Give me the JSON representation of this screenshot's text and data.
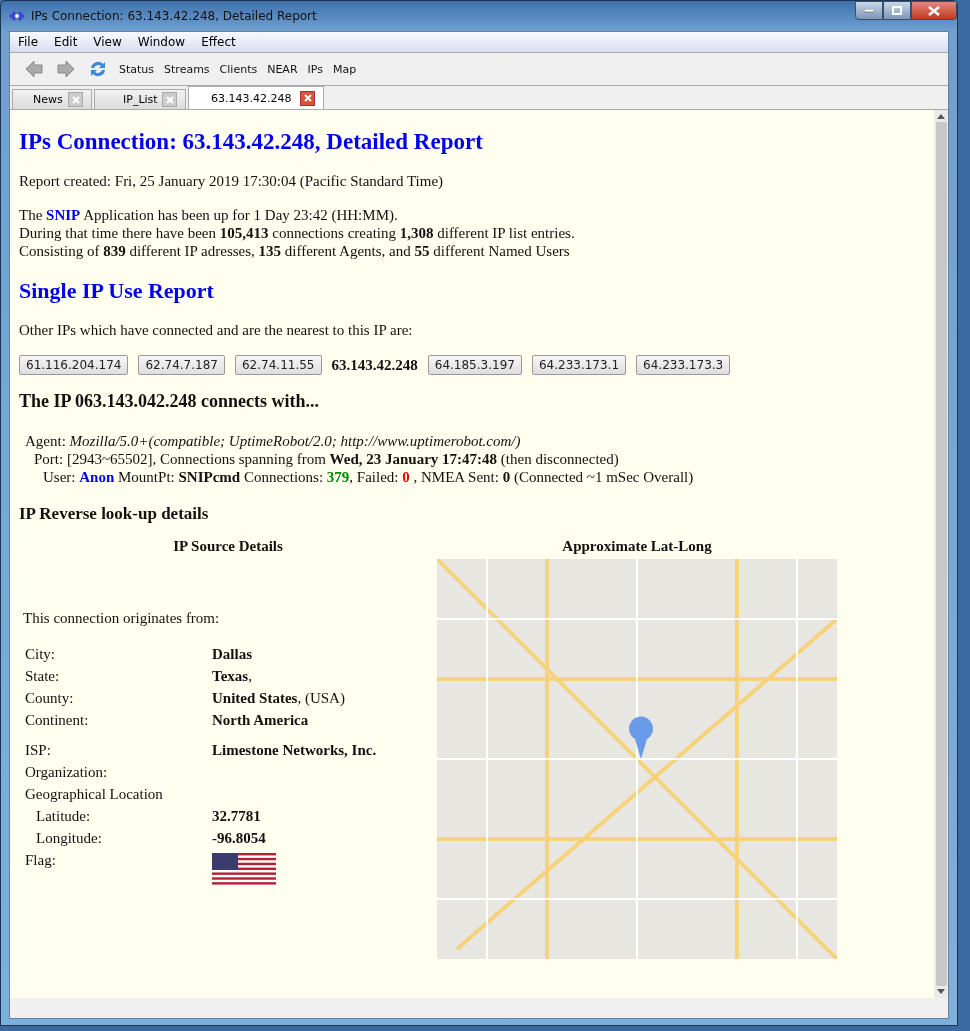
{
  "window": {
    "title": "IPs Connection: 63.143.42.248, Detailed Report"
  },
  "menu": [
    "File",
    "Edit",
    "View",
    "Window",
    "Effect"
  ],
  "toolbar": [
    "Status",
    "Streams",
    "Clients",
    "NEAR",
    "IPs",
    "Map"
  ],
  "tabs": [
    {
      "label": "News",
      "selected": false
    },
    {
      "label": "IP_List",
      "selected": false
    },
    {
      "label": "63.143.42.248",
      "selected": true
    }
  ],
  "report": {
    "title": "IPs Connection: 63.143.42.248, Detailed Report",
    "created": "Report created: Fri, 25 January 2019 17:30:04 (Pacific Standard Time)",
    "summary": [
      [
        {
          "kind": "text",
          "text": "The "
        },
        {
          "kind": "link",
          "text": "SNIP"
        },
        {
          "kind": "text",
          "text": " Application has been up for 1 Day 23:42 (HH:MM)."
        }
      ],
      [
        {
          "kind": "text",
          "text": "During that time there have been **105,413** connections creating **1,308** different IP list entries."
        }
      ],
      [
        {
          "kind": "text",
          "text": "Consisting of **839** different IP adresses, **135** different Agents, and **55** different Named Users"
        }
      ]
    ],
    "section_title": "Single IP Use Report",
    "nearest_intro": "Other IPs which have connected and are the nearest to this IP are:",
    "nearest_ips": [
      {
        "label": "61.116.204.174",
        "selected": false
      },
      {
        "label": "62.74.7.187",
        "selected": false
      },
      {
        "label": "62.74.11.55",
        "selected": false
      },
      {
        "label": "63.143.42.248",
        "selected": true
      },
      {
        "label": "64.185.3.197",
        "selected": false
      },
      {
        "label": "64.233.173.1",
        "selected": false
      },
      {
        "label": "64.233.173.3",
        "selected": false
      }
    ],
    "connects_title": "The IP 063.143.042.248 connects with...",
    "connection_lines": [
      [
        {
          "kind": "text",
          "text": "Agent: *Mozilla/5.0+(compatible; UptimeRobot/2.0; http://www.uptimerobot.com/)*"
        }
      ],
      [
        {
          "kind": "text",
          "text": "Port: [2943~65502], Connections spanning from **Wed, 23 January 17:47:48** (then disconnected)"
        }
      ],
      [
        {
          "kind": "text",
          "text": "User: "
        },
        {
          "kind": "link",
          "text": "Anon"
        },
        {
          "kind": "text",
          "text": " MountPt: **SNIPcmd** Connections: "
        },
        {
          "kind": "good",
          "text": "379"
        },
        {
          "kind": "text",
          "text": ", Failed: "
        },
        {
          "kind": "bad",
          "text": "0"
        },
        {
          "kind": "text",
          "text": " , NMEA Sent: **0** (Connected ~1 mSec Overall)"
        }
      ]
    ],
    "lookup_title": "IP Reverse look-up details",
    "source_heading": "IP Source Details",
    "map_heading": "Approximate Lat-Long",
    "origin_intro": "This connection originates from:",
    "detail_groups": [
      [
        {
          "label": "City:",
          "value": "Dallas"
        },
        {
          "label": "State:",
          "value": "Texas",
          "suffix": ","
        },
        {
          "label": "County:",
          "value": "United States",
          "suffix": ", (USA)"
        },
        {
          "label": "Continent:",
          "value": "North America"
        }
      ],
      [
        {
          "label": "ISP:",
          "value": "Limestone Networks, Inc."
        },
        {
          "label": "Organization:"
        },
        {
          "label": "Geographical Location",
          "children": [
            {
              "label": "Latitude:",
              "value": "32.7781"
            },
            {
              "label": "Longitude:",
              "value": "-96.8054"
            }
          ]
        },
        {
          "label": "Flag:",
          "kind": "flag"
        }
      ]
    ]
  }
}
